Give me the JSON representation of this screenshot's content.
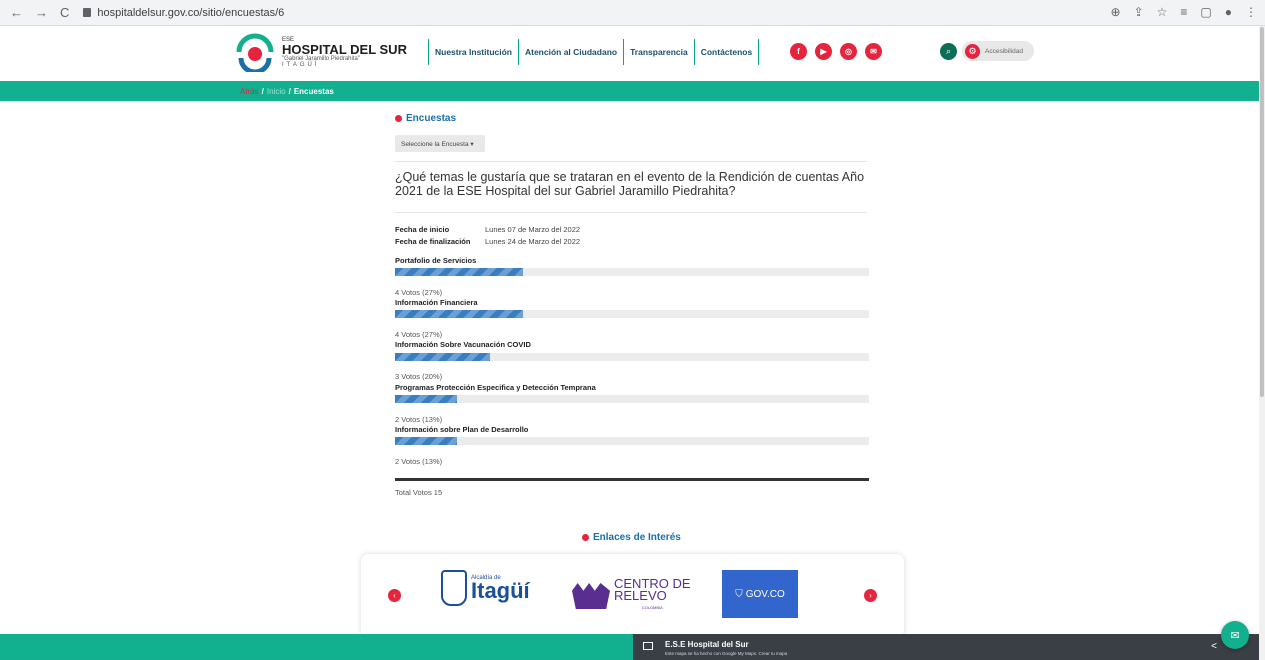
{
  "browser": {
    "url": "hospitaldelsur.gov.co/sitio/encuestas/6",
    "back": "←",
    "forward": "→",
    "reload": "C",
    "right_icons": [
      "⊕",
      "⇪",
      "☆",
      "≡",
      "▢",
      "●",
      "⋮"
    ]
  },
  "header": {
    "logo": {
      "ese": "ESE",
      "name": "HOSPITAL DEL SUR",
      "sub": "\"Gabriel Jaramillo Piedrahita\"",
      "city": "ITAGÜÍ"
    },
    "nav": [
      "Nuestra Institución",
      "Atención al Ciudadano",
      "Transparencia",
      "Contáctenos"
    ],
    "social": [
      "f",
      "▶",
      "◎",
      "✉"
    ],
    "search_icon": "⌕",
    "accessibility_label": "Accesibilidad",
    "gear_icon": "⚙"
  },
  "breadcrumb": {
    "home": "Atrás",
    "sep1": "/",
    "inicio": "Inicio",
    "sep2": "/",
    "current": "Encuestas"
  },
  "survey": {
    "section_title": "Encuestas",
    "select_label": "Seleccione la Encuesta ▾",
    "question": "¿Qué temas le gustaría que se trataran en el evento de la Rendición de cuentas Año 2021 de la ESE Hospital del sur Gabriel Jaramillo Piedrahita?",
    "start_label": "Fecha de inicio",
    "start_value": "Lunes 07 de Marzo del 2022",
    "end_label": "Fecha de finalización",
    "end_value": "Lunes 24 de Marzo del 2022",
    "options": [
      {
        "label": "Portafolio de Servicios",
        "votes": "4 Votos (27%)",
        "percent": 27
      },
      {
        "label": "Información Financiera",
        "votes": "4 Votos (27%)",
        "percent": 27
      },
      {
        "label": "Información Sobre Vacunación COVID",
        "votes": "3 Votos (20%)",
        "percent": 20
      },
      {
        "label": "Programas Protección Especifica y Detección Temprana",
        "votes": "2 Votos (13%)",
        "percent": 13
      },
      {
        "label": "Información sobre Plan de Desarrollo",
        "votes": "2 Votos (13%)",
        "percent": 13
      }
    ],
    "total": "Total Votos 15"
  },
  "links": {
    "title": "Enlaces de Interés",
    "prev": "‹",
    "next": "›",
    "itagui_top": "Alcaldía de",
    "itagui": "Itagüí",
    "relevo_line1": "CENTRO DE",
    "relevo_line2": "RELEVO",
    "relevo_line3": "COLOMBIA",
    "gov": "GOV.CO"
  },
  "map": {
    "title": "E.S.E Hospital del Sur",
    "subtitle": "Este mapa se ha hecho con Google My Maps. Crear tu mapa",
    "share_icon": "<"
  },
  "chat_icon": "✉",
  "colors": {
    "teal": "#12b08e",
    "red": "#e6243e",
    "blue": "#1b6fa8"
  }
}
